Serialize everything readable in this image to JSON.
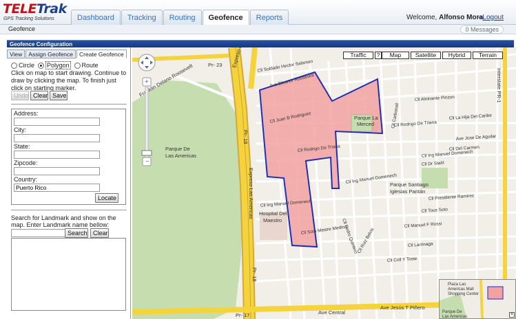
{
  "brand": {
    "logo_part1": "TELE",
    "logo_part2": "Trak",
    "tagline": "GPS Tracking Solutions"
  },
  "nav": {
    "tabs": [
      {
        "label": "Dashboard",
        "active": false
      },
      {
        "label": "Tracking",
        "active": false
      },
      {
        "label": "Routing",
        "active": false
      },
      {
        "label": "Geofence",
        "active": true
      },
      {
        "label": "Reports",
        "active": false
      }
    ],
    "welcome_prefix": "Welcome,",
    "user_name": "Alfonso Mora",
    "logout_label": "Logout"
  },
  "subbar": {
    "crumb": "Geofence",
    "messages": "0 Messages"
  },
  "config": {
    "title": "Geofence Configuration",
    "subtabs": [
      "View",
      "Assign Geofence",
      "Create Geofence"
    ],
    "active_subtab": "Create Geofence",
    "shape_options": [
      "Circle",
      "Polygon",
      "Route"
    ],
    "selected_shape": "Polygon",
    "instructions": "Click on map to start drawing. Continue to draw by clicking the map. To finish just click on starting marker.",
    "undo_label": "Undo",
    "clear_label": "Clear",
    "save_label": "Save",
    "address": {
      "address_label": "Address:",
      "city_label": "City:",
      "state_label": "State:",
      "zipcode_label": "Zipcode:",
      "country_label": "Country:",
      "address_value": "",
      "city_value": "",
      "state_value": "",
      "zipcode_value": "",
      "country_value": "Puerto Rico",
      "locate_label": "Locate"
    },
    "landmark": {
      "text": "Search for Landmark and show on the map. Enter Landmark name bellow:",
      "search_label": "Search",
      "clear_label": "Clear",
      "query": ""
    }
  },
  "map": {
    "traffic_label": "Traffic",
    "help_label": "?",
    "map_label": "Map",
    "satellite_label": "Satellite",
    "hybrid_label": "Hybrid",
    "terrain_label": "Terrain",
    "colors": {
      "highway": "#f5d33c",
      "park": "#c6ddb0",
      "geofence_fill": "#f2a2a2",
      "geofence_stroke": "#1f2fb5"
    },
    "labels": {
      "park_name_1": "Parque De",
      "park_name_2": "Las Americas",
      "pr23": "Pr- 23",
      "pr18a": "Pr- 18",
      "pr18b": "Pr- 18",
      "pr17": "Pr- 17",
      "expreso": "Expreso Las Americas",
      "expreso_top": "Expreso Las Americas",
      "roosevelt": "Franklin Delano Roosevelt",
      "ave_central": "Ave Central",
      "ave_jesus": "Ave Jesús T Piñero",
      "hospital_1": "Hospital Del",
      "hospital_2": "Maestro",
      "parque_merced_1": "Parque La",
      "parque_merced_2": "Merced",
      "parque_santiago_1": "Parque Santiago",
      "parque_santiago_2": "Iglesias Pantán",
      "plaza_1": "Plaza Las",
      "plaza_2": "Americas Mall",
      "plaza_3": "Shopping Center",
      "plaza_4": "Parque De",
      "plaza_5": "Las Americas",
      "interstate": "Interstate PR-1",
      "st_soldado_hector": "Cll Soldado Hector Salaman",
      "st_eleanor": "Ave Eleanor Roosevelt",
      "st_juan_b": "Cll Juan B Rodriguez",
      "st_rodrigo_triana": "Cll Rodrigo De Triana",
      "st_rodrigo_triana2": "Cll Rodrigo De Triana",
      "st_manuel_domenech": "Cll Ing Manuel Domenech",
      "st_manuel_domenech2": "Cll Ing Manuel Domenech",
      "st_manuel_domenech3": "Cll Ing Manuel Domenech",
      "st_carbonell": "Cll Carbonell",
      "st_la_hija": "Cll La Hija Del Caribe",
      "st_aguilar": "Ave Jose De Aguilar",
      "st_amirante": "Cll Almirante Pinzon",
      "st_del_carmen": "Cll Del Carmen",
      "st_dr_stahl": "Cll Dr Stahl",
      "st_presidente": "Cll Presidente Ramirez",
      "st_tous_soto": "Cll Tous Soto",
      "st_manuel_f": "Cll Manuel F Rossi",
      "st_larrinaga": "Cll Larrinaga",
      "st_coll_toste": "Cll Coll Y Toste",
      "st_soto": "Cll Soto Mestre Medina",
      "st_ruiz": "Cll Ruiz Belvis",
      "st_pedro": "Cll Pedro Quintero"
    }
  }
}
